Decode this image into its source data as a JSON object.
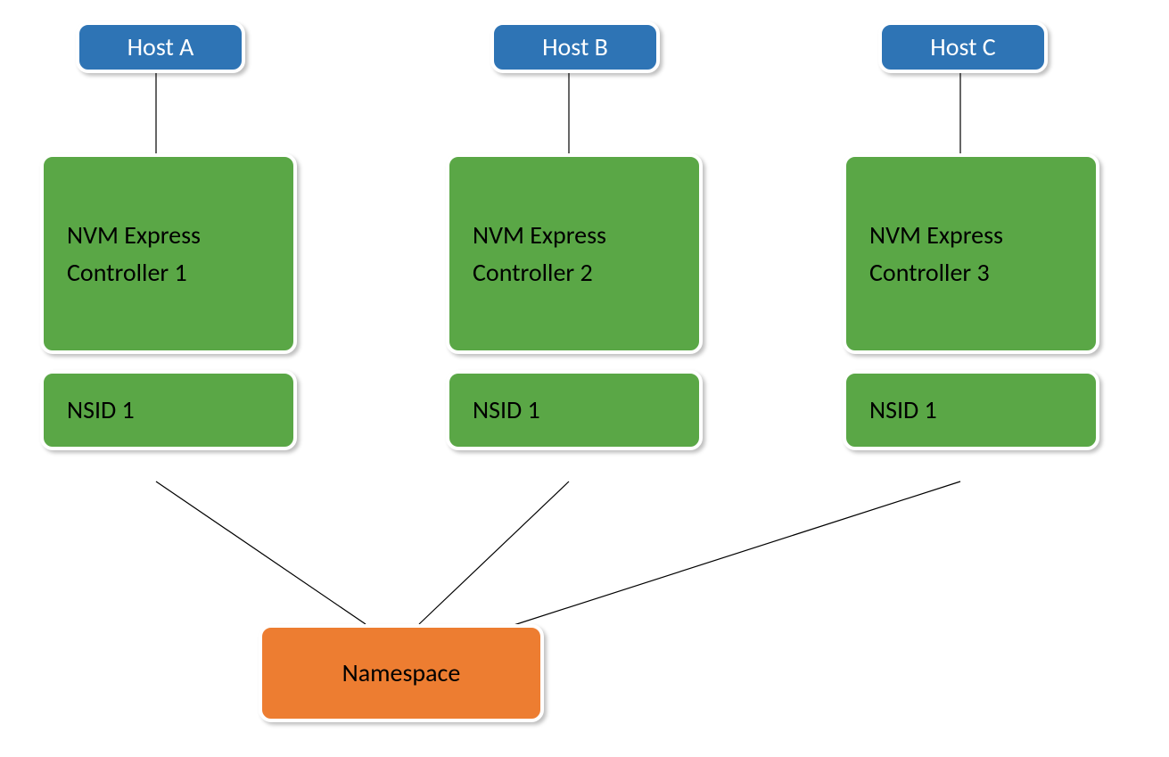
{
  "hosts": {
    "a": "Host A",
    "b": "Host B",
    "c": "Host C"
  },
  "controllers": {
    "a": "NVM Express Controller 1",
    "b": "NVM Express Controller 2",
    "c": "NVM Express Controller 3"
  },
  "nsids": {
    "a": "NSID 1",
    "b": "NSID 1",
    "c": "NSID 1"
  },
  "namespace": "Namespace",
  "colors": {
    "host": "#2e74b5",
    "controller": "#5aa746",
    "nsid": "#5aa746",
    "namespace": "#ed7d31",
    "border": "#ffffff"
  }
}
